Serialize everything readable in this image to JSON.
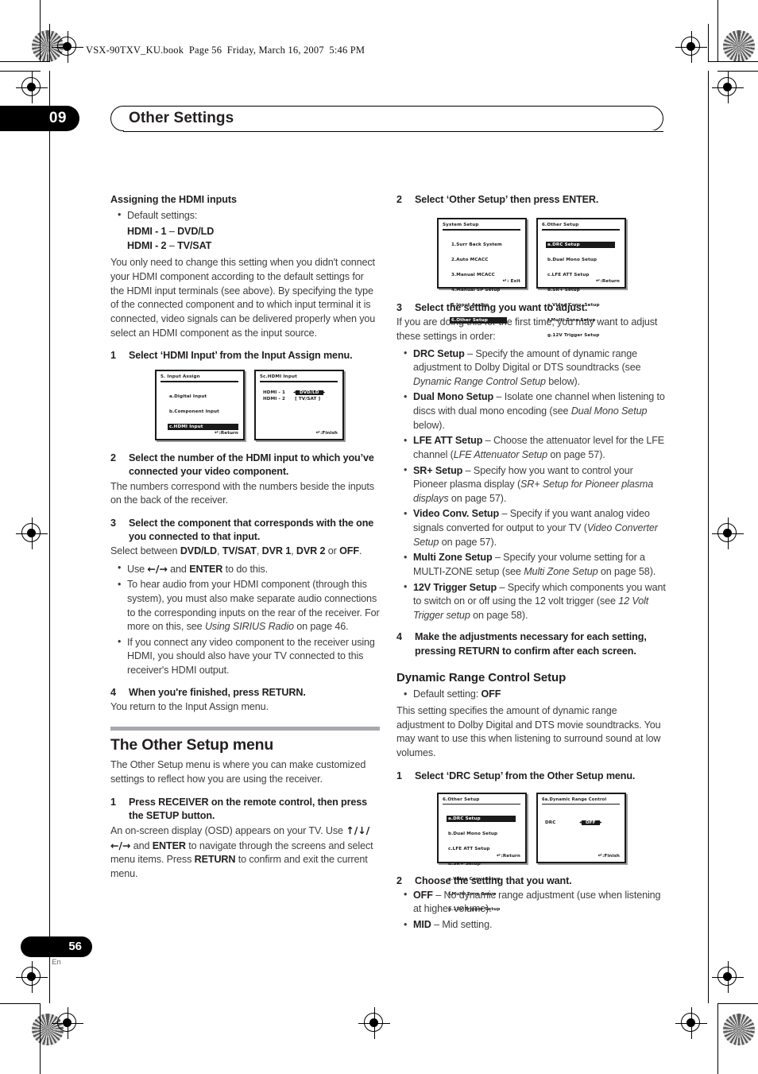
{
  "file_header": "VSX-90TXV_KU.book  Page 56  Friday, March 16, 2007  5:46 PM",
  "chapter": {
    "number": "09",
    "title": "Other Settings"
  },
  "footer": {
    "page": "56",
    "lang": "En"
  },
  "left_column": {
    "heading": "Assigning the HDMI inputs",
    "default_bullet": "Default settings:",
    "default_line1_label": "HDMI - 1",
    "default_line1_value": "DVD/LD",
    "default_line2_label": "HDMI - 2",
    "default_line2_value": "TV/SAT",
    "intro": "You only need to change this setting when you didn't connect your HDMI component according to the default settings for the HDMI input terminals (see above). By specifying the type of the connected component and to which input terminal it is connected, video signals can be delivered properly when you select an HDMI component as the input source.",
    "step1_num": "1",
    "step1": "Select ‘HDMI Input’ from the Input Assign menu.",
    "step2_num": "2",
    "step2": "Select the number of the HDMI input to which you’ve connected your video component.",
    "step2_body": "The numbers correspond with the numbers beside the inputs on the back of the receiver.",
    "step3_num": "3",
    "step3": "Select the component that corresponds with the one you connected to that input.",
    "step3_body_pre": "Select between ",
    "step3_opt1": "DVD/LD",
    "step3_opt2": "TV/SAT",
    "step3_opt3": "DVR 1",
    "step3_opt4": "DVR 2",
    "step3_opt5": "OFF",
    "bullet_use_pre": "Use ",
    "bullet_use_arrows": "←/→",
    "bullet_use_mid": " and ",
    "bullet_use_enter": "ENTER",
    "bullet_use_post": " to do this.",
    "bullet_audio": "To hear audio from your HDMI component (through this system), you must also make separate audio connections to the corresponding inputs on the rear of the receiver. For more on this, see ",
    "bullet_audio_italic": "Using SIRIUS Radio",
    "bullet_audio_post": " on page 46.",
    "bullet_video": "If you connect any video component to the receiver using HDMI, you should also have your TV connected to this receiver's HDMI output.",
    "step4_num": "4",
    "step4": "When you're finished, press RETURN.",
    "step4_body": "You return to the Input Assign menu.",
    "other_setup_heading": "The Other Setup menu",
    "other_setup_body": "The Other Setup menu is where you can make customized settings to reflect how you are using the receiver.",
    "osm_step1_num": "1",
    "osm_step1": "Press RECEIVER on the remote control, then press the SETUP button.",
    "osm_step1_body_pre": "An on-screen display (OSD) appears on your TV. Use ",
    "osm_step1_arrows": "↑/↓/←/→",
    "osm_step1_body_mid": " and ",
    "osm_step1_enter": "ENTER",
    "osm_step1_body_mid2": " to navigate through the screens and select menu items. Press ",
    "osm_step1_return": "RETURN",
    "osm_step1_body_post": " to confirm and exit the current menu."
  },
  "right_column": {
    "step2_num": "2",
    "step2": "Select ‘Other Setup’ then press ENTER.",
    "step3_num": "3",
    "step3": "Select the setting you want to adjust.",
    "step3_body": "If you are doing this for the first time, you may want to adjust these settings in order:",
    "bullets": [
      {
        "label": "DRC Setup",
        "text_pre": " – Specify the amount of dynamic range adjustment to Dolby Digital or DTS soundtracks (see ",
        "italic": "Dynamic Range Control Setup",
        "text_post": " below)."
      },
      {
        "label": "Dual Mono Setup",
        "text_pre": " – Isolate one channel when listening to discs with dual mono encoding (see ",
        "italic": "Dual Mono Setup",
        "text_post": " below)."
      },
      {
        "label": "LFE ATT Setup",
        "text_pre": " – Choose the attenuator level for the LFE channel (",
        "italic": "LFE Attenuator Setup",
        "text_post": " on page 57)."
      },
      {
        "label": "SR+ Setup",
        "text_pre": " – Specify how you want to control your Pioneer plasma display (",
        "italic": "SR+ Setup for Pioneer plasma displays",
        "text_post": " on page 57)."
      },
      {
        "label": "Video Conv. Setup",
        "text_pre": " – Specify if you want analog video signals converted for output to your TV (",
        "italic": "Video Converter Setup",
        "text_post": " on page 57)."
      },
      {
        "label": "Multi Zone Setup",
        "text_pre": " – Specify your volume setting for a MULTI-ZONE setup (see ",
        "italic": "Multi Zone Setup",
        "text_post": " on page 58)."
      },
      {
        "label": "12V Trigger Setup",
        "text_pre": " – Specify which components you want to switch on or off using the 12 volt trigger (see ",
        "italic": "12 Volt Trigger setup",
        "text_post": " on page 58)."
      }
    ],
    "step4_num": "4",
    "step4": "Make the adjustments necessary for each setting, pressing RETURN to confirm after each screen.",
    "drc_heading": "Dynamic Range Control Setup",
    "drc_default_pre": "Default setting: ",
    "drc_default_value": "OFF",
    "drc_body": "This setting specifies the amount of dynamic range adjustment to Dolby Digital and DTS movie soundtracks. You may want to use this when listening to surround sound at low volumes.",
    "drc_step1_num": "1",
    "drc_step1": "Select ‘DRC Setup’ from the Other Setup menu.",
    "drc_step2_num": "2",
    "drc_step2": "Choose the setting that you want.",
    "drc_opt1_label": "OFF",
    "drc_opt1_text": " – No dynamic range adjustment (use when listening at higher volume).",
    "drc_opt2_label": "MID",
    "drc_opt2_text": " – Mid setting."
  },
  "osd_screens": {
    "input_assign": {
      "title": "5. Input  Assign",
      "items": [
        "a.Digital  Input",
        "b.Component  Input",
        "c.HDMI Input"
      ],
      "selected_index": 2,
      "footer": ":Return"
    },
    "hdmi_input": {
      "title": "5c.HDMI  Input",
      "rows": [
        {
          "key": "HDMI - 1",
          "value": "DVD/LD",
          "highlighted": true
        },
        {
          "key": "HDMI - 2",
          "value": "TV/SAT",
          "highlighted": false
        }
      ],
      "footer": ":Finish"
    },
    "system_setup": {
      "title": "System  Setup",
      "items": [
        "1.Surr  Back  System",
        "2.Auto  MCACC",
        "3.Manual  MCACC",
        "4.Manual  SP  Setup",
        "5.Input  Assign",
        "6.Other  Setup"
      ],
      "selected_index": 5,
      "footer": ": Exit"
    },
    "other_setup": {
      "title": "6.Other  Setup",
      "items": [
        "a.DRC  Setup",
        "b.Dual  Mono  Setup",
        "c.LFE  ATT  Setup",
        "d.SR+  Setup",
        "e.Video Conv. Setup",
        "f.Multi Zone Setup",
        "g.12V Trigger Setup"
      ],
      "selected_index": 0,
      "footer": ":Return"
    },
    "drc_screen": {
      "title": "6a.Dynamic  Range  Control",
      "key": "DRC",
      "value": "OFF",
      "footer": ":Finish"
    }
  }
}
